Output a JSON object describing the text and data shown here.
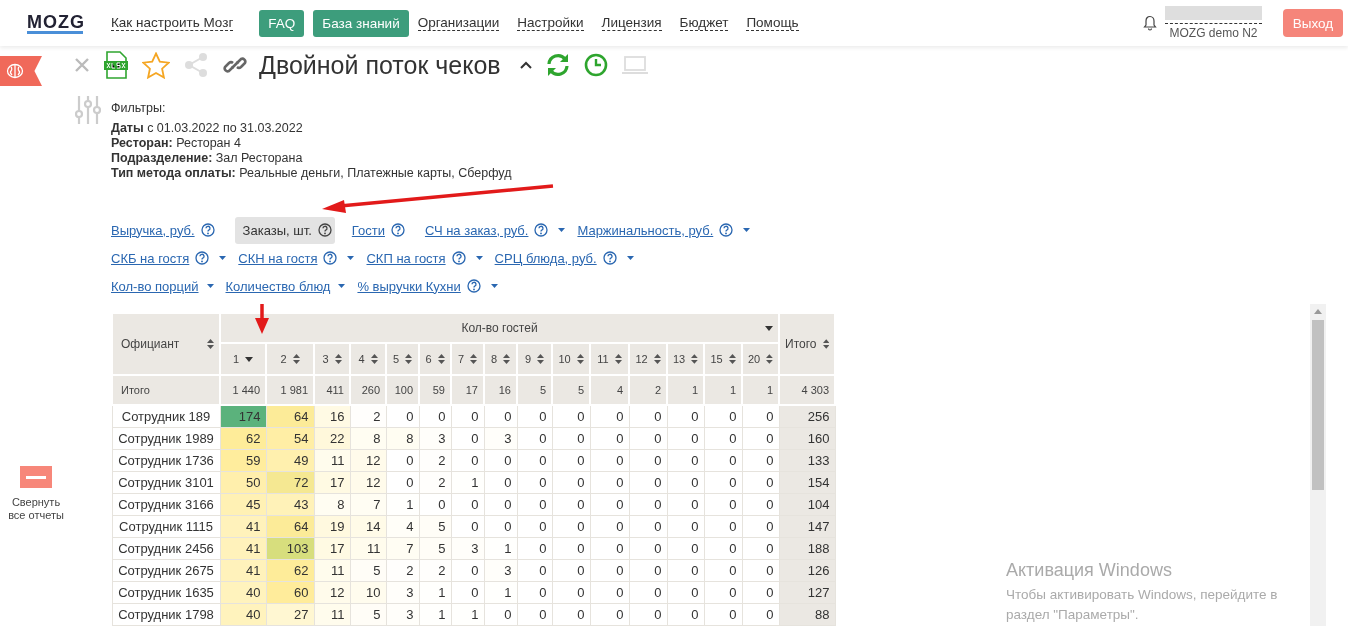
{
  "nav": {
    "logo": "MOZG",
    "links": [
      {
        "label": "Как настроить Мозг",
        "kind": "link"
      },
      {
        "label": "FAQ",
        "kind": "button"
      },
      {
        "label": "База знаний",
        "kind": "button"
      },
      {
        "label": "Организации",
        "kind": "link"
      },
      {
        "label": "Настройки",
        "kind": "link"
      },
      {
        "label": "Лицензия",
        "kind": "link"
      },
      {
        "label": "Бюджет",
        "kind": "link"
      },
      {
        "label": "Помощь",
        "kind": "link"
      }
    ],
    "user": {
      "name": "MOZG demo N2"
    },
    "logout": "Выход"
  },
  "sidebar": {
    "collapse_label": "Свернуть все отчеты"
  },
  "report": {
    "title": "Двойной поток чеков",
    "filters_label": "Фильтры:",
    "filters": [
      "**Даты** с 01.03.2022 по 31.03.2022",
      "**Ресторан:** Ресторан 4",
      "**Подразделение:** Зал Ресторана",
      "**Тип метода оплаты:** Реальные деньги, Платежные карты, Сберфуд"
    ],
    "metric_rows": [
      [
        {
          "label": "Выручка, руб.",
          "help": true,
          "dropdown": false,
          "selected": false
        },
        {
          "label": "Заказы, шт.",
          "help": true,
          "dropdown": false,
          "selected": true
        },
        {
          "label": "Гости",
          "help": true,
          "dropdown": false,
          "selected": false
        },
        {
          "label": "СЧ на заказ, руб.",
          "help": true,
          "dropdown": true,
          "selected": false
        },
        {
          "label": "Маржинальность, руб.",
          "help": true,
          "dropdown": true,
          "selected": false
        }
      ],
      [
        {
          "label": "СКБ на гостя",
          "help": true,
          "dropdown": true,
          "selected": false
        },
        {
          "label": "СКН на гостя",
          "help": true,
          "dropdown": true,
          "selected": false
        },
        {
          "label": "СКП на гостя",
          "help": true,
          "dropdown": true,
          "selected": false
        },
        {
          "label": "СРЦ блюда, руб.",
          "help": true,
          "dropdown": true,
          "selected": false
        }
      ],
      [
        {
          "label": "Кол-во порций",
          "help": false,
          "dropdown": true,
          "selected": false
        },
        {
          "label": "Количество блюд",
          "help": false,
          "dropdown": true,
          "selected": false
        },
        {
          "label": "% выручки Кухни",
          "help": true,
          "dropdown": true,
          "selected": false
        }
      ]
    ]
  },
  "table": {
    "row_header": "Официант",
    "group_header": "Кол-во гостей",
    "total_header": "Итого",
    "columns": [
      {
        "label": "1",
        "sorted": true
      },
      {
        "label": "2",
        "sorted": false
      },
      {
        "label": "3",
        "sorted": false
      },
      {
        "label": "4",
        "sorted": false
      },
      {
        "label": "5",
        "sorted": false
      },
      {
        "label": "6",
        "sorted": false
      },
      {
        "label": "7",
        "sorted": false
      },
      {
        "label": "8",
        "sorted": false
      },
      {
        "label": "9",
        "sorted": false
      },
      {
        "label": "10",
        "sorted": false
      },
      {
        "label": "11",
        "sorted": false
      },
      {
        "label": "12",
        "sorted": false
      },
      {
        "label": "13",
        "sorted": false
      },
      {
        "label": "15",
        "sorted": false
      },
      {
        "label": "20",
        "sorted": false
      }
    ],
    "totals": {
      "label": "Итого",
      "values": [
        "1 440",
        "1 981",
        "411",
        "260",
        "100",
        "59",
        "17",
        "16",
        "5",
        "5",
        "4",
        "2",
        "1",
        "1",
        "1"
      ],
      "total": "4 303"
    },
    "rows": [
      {
        "name": "Сотрудник 189",
        "values": [
          "174",
          "64",
          "16",
          "2",
          "0",
          "0",
          "0",
          "0",
          "0",
          "0",
          "0",
          "0",
          "0",
          "0",
          "0"
        ],
        "total": "256"
      },
      {
        "name": "Сотрудник 1989",
        "values": [
          "62",
          "54",
          "22",
          "8",
          "8",
          "3",
          "0",
          "3",
          "0",
          "0",
          "0",
          "0",
          "0",
          "0",
          "0"
        ],
        "total": "160"
      },
      {
        "name": "Сотрудник 1736",
        "values": [
          "59",
          "49",
          "11",
          "12",
          "0",
          "2",
          "0",
          "0",
          "0",
          "0",
          "0",
          "0",
          "0",
          "0",
          "0"
        ],
        "total": "133"
      },
      {
        "name": "Сотрудник 3101",
        "values": [
          "50",
          "72",
          "17",
          "12",
          "0",
          "2",
          "1",
          "0",
          "0",
          "0",
          "0",
          "0",
          "0",
          "0",
          "0"
        ],
        "total": "154"
      },
      {
        "name": "Сотрудник 3166",
        "values": [
          "45",
          "43",
          "8",
          "7",
          "1",
          "0",
          "0",
          "0",
          "0",
          "0",
          "0",
          "0",
          "0",
          "0",
          "0"
        ],
        "total": "104"
      },
      {
        "name": "Сотрудник 1115",
        "values": [
          "41",
          "64",
          "19",
          "14",
          "4",
          "5",
          "0",
          "0",
          "0",
          "0",
          "0",
          "0",
          "0",
          "0",
          "0"
        ],
        "total": "147"
      },
      {
        "name": "Сотрудник 2456",
        "values": [
          "41",
          "103",
          "17",
          "11",
          "7",
          "5",
          "3",
          "1",
          "0",
          "0",
          "0",
          "0",
          "0",
          "0",
          "0"
        ],
        "total": "188"
      },
      {
        "name": "Сотрудник 2675",
        "values": [
          "41",
          "62",
          "11",
          "5",
          "2",
          "2",
          "0",
          "3",
          "0",
          "0",
          "0",
          "0",
          "0",
          "0",
          "0"
        ],
        "total": "126"
      },
      {
        "name": "Сотрудник 1635",
        "values": [
          "40",
          "60",
          "12",
          "10",
          "3",
          "1",
          "0",
          "1",
          "0",
          "0",
          "0",
          "0",
          "0",
          "0",
          "0"
        ],
        "total": "127"
      },
      {
        "name": "Сотрудник 1798",
        "values": [
          "40",
          "27",
          "11",
          "5",
          "3",
          "1",
          "1",
          "0",
          "0",
          "0",
          "0",
          "0",
          "0",
          "0",
          "0"
        ],
        "total": "88"
      }
    ]
  },
  "os_notice": {
    "title": "Активация Windows",
    "lines": [
      "Чтобы активировать Windows, перейдите в",
      "раздел \"Параметры\"."
    ]
  }
}
